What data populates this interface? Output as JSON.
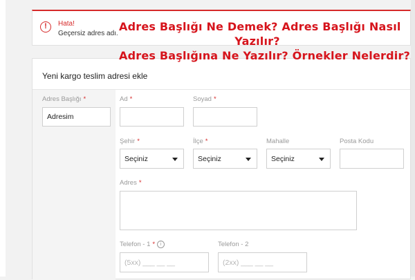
{
  "alert": {
    "title": "Hata!",
    "message": "Geçersiz adres adı."
  },
  "overlay": {
    "line1": "Adres Başlığı Ne Demek? Adres Başlığı Nasıl",
    "line2": "Yazılır?",
    "line3": "Adres Başlığına Ne Yazılır? Örnekler Nelerdir?"
  },
  "form": {
    "title": "Yeni kargo teslim adresi ekle",
    "address_title": {
      "label": "Adres Başlığı",
      "value": "Adresim"
    },
    "first_name": {
      "label": "Ad",
      "value": ""
    },
    "last_name": {
      "label": "Soyad",
      "value": ""
    },
    "city": {
      "label": "Şehir",
      "value": "Seçiniz"
    },
    "district": {
      "label": "İlçe",
      "value": "Seçiniz"
    },
    "neighborhood": {
      "label": "Mahalle",
      "value": "Seçiniz"
    },
    "postal_code": {
      "label": "Posta Kodu",
      "value": ""
    },
    "address": {
      "label": "Adres",
      "value": ""
    },
    "phone1": {
      "label": "Telefon - 1",
      "placeholder": "(5xx) ___ __ __"
    },
    "phone2": {
      "label": "Telefon - 2",
      "placeholder": "(2xx) ___ __ __"
    }
  },
  "colors": {
    "accent": "#d62a2a",
    "overlay_text": "#d6141c"
  }
}
